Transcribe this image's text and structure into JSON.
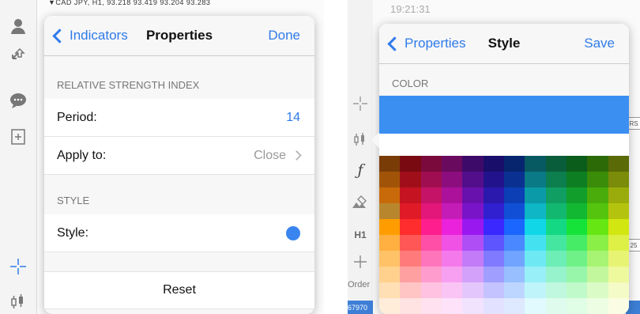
{
  "screen1": {
    "chart_title": "▼CAD JPY, H1, 93.218 93.419 93.204 93.283",
    "toolbar_icons": [
      "account-icon",
      "trade-icon",
      "chat-icon",
      "new-document-icon",
      "crosshair-icon",
      "indicators-icon"
    ],
    "nav": {
      "back_label": "Indicators",
      "title": "Properties",
      "action_label": "Done"
    },
    "section1_header": "RELATIVE STRENGTH INDEX",
    "rows1": [
      {
        "label": "Period:",
        "value": "14"
      },
      {
        "label": "Apply to:",
        "value": "Close"
      }
    ],
    "section2_header": "STYLE",
    "style_row": {
      "label": "Style:",
      "dot_color": "#3a84f0"
    },
    "reset_label": "Reset"
  },
  "screen2": {
    "bg_time": "19:21:31",
    "toolbar_icons": [
      "crosshair-icon",
      "indicators-icon",
      "function-icon",
      "objects-icon",
      "timeframe-icon",
      "plus-icon"
    ],
    "timeframe_label": "H1",
    "order_label": "Order",
    "order_number": "67970",
    "nav": {
      "back_label": "Properties",
      "title": "Style",
      "action_label": "Save"
    },
    "color_header": "COLOR",
    "selected_color": "#3a8ff1",
    "side_labels": [
      "RS",
      "25"
    ],
    "palette": [
      [
        "#7a3c07",
        "#7a0a12",
        "#7a0a3c",
        "#6a0a5e",
        "#3e0a6a",
        "#1a0e6b",
        "#07246f",
        "#075a62",
        "#0a5d3a",
        "#0a5d1a",
        "#2c6a07",
        "#5a6a07"
      ],
      [
        "#a15408",
        "#a00e1a",
        "#a00e52",
        "#8c0e7e",
        "#530e8c",
        "#22138c",
        "#0a3191",
        "#097a86",
        "#0d7e4e",
        "#0e7e22",
        "#3b8c09",
        "#7a8c09"
      ],
      [
        "#c86a0a",
        "#c51321",
        "#c51368",
        "#ac119c",
        "#6911ac",
        "#2b18ad",
        "#0c3eb6",
        "#0b9aa8",
        "#109e62",
        "#119e2b",
        "#49ac0b",
        "#9aac0b"
      ],
      [
        "#b8862c",
        "#e01b27",
        "#e3167a",
        "#c41cb7",
        "#7a14c8",
        "#3020d0",
        "#1150d6",
        "#0eb6c6",
        "#12b870",
        "#13b832",
        "#54c40e",
        "#b4c40e"
      ],
      [
        "#ff9d00",
        "#ff2d2d",
        "#ff1e8e",
        "#ea22dc",
        "#9a18f0",
        "#3a28ff",
        "#1a66ff",
        "#10d6e8",
        "#14d884",
        "#16e33a",
        "#66e612",
        "#d2e612"
      ],
      [
        "#ffb040",
        "#ff5656",
        "#ff4fa7",
        "#f052e6",
        "#b04ef6",
        "#5e55ff",
        "#4a88ff",
        "#44e2f0",
        "#45e6a0",
        "#47ec66",
        "#8aef46",
        "#def046"
      ],
      [
        "#ffc266",
        "#ff7b7b",
        "#ff75bb",
        "#f47aec",
        "#c37bf8",
        "#7f7aff",
        "#70a4ff",
        "#6ee9f4",
        "#6deeb6",
        "#70f188",
        "#a7f373",
        "#e7f473"
      ],
      [
        "#ffd18d",
        "#ffa0a0",
        "#ff9cce",
        "#f7a0f1",
        "#d3a1fa",
        "#a09eff",
        "#98bfff",
        "#98eff7",
        "#96f3cb",
        "#98f6aa",
        "#c2f79d",
        "#eef89d"
      ],
      [
        "#ffdfb3",
        "#ffc4c4",
        "#ffc2e0",
        "#fac5f5",
        "#e3c6fc",
        "#c5c3ff",
        "#bdd6ff",
        "#bff5fa",
        "#bff8de",
        "#c0facb",
        "#dbfbc6",
        "#f4fbc6"
      ],
      [
        "#ffedd9",
        "#ffe2e2",
        "#ffe1f0",
        "#fde2fa",
        "#f1e3fe",
        "#e2e1ff",
        "#dee9ff",
        "#e0fafd",
        "#dffbee",
        "#e0fde6",
        "#edfde3",
        "#fafde3"
      ]
    ]
  }
}
